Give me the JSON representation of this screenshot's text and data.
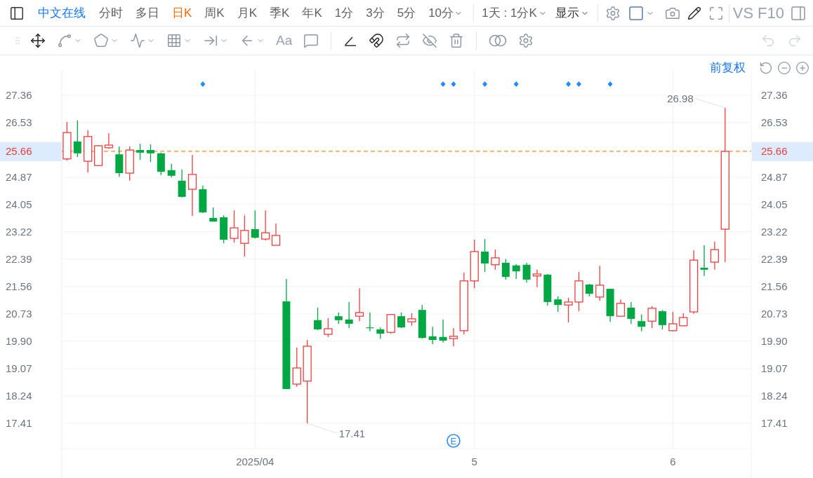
{
  "toolbar": {
    "stock_name": "中文在线",
    "periods": [
      {
        "label": "分时",
        "selected": false,
        "dropdown": false
      },
      {
        "label": "多日",
        "selected": false,
        "dropdown": false
      },
      {
        "label": "日K",
        "selected": true,
        "dropdown": false
      },
      {
        "label": "周K",
        "selected": false,
        "dropdown": false
      },
      {
        "label": "月K",
        "selected": false,
        "dropdown": false
      },
      {
        "label": "季K",
        "selected": false,
        "dropdown": false
      },
      {
        "label": "年K",
        "selected": false,
        "dropdown": false
      },
      {
        "label": "1分",
        "selected": false,
        "dropdown": false
      },
      {
        "label": "3分",
        "selected": false,
        "dropdown": false
      },
      {
        "label": "5分",
        "selected": false,
        "dropdown": false
      },
      {
        "label": "10分",
        "selected": false,
        "dropdown": true
      }
    ],
    "range": "1天 : 1分K",
    "display": "显示",
    "buttons": [
      "VS",
      "F10"
    ]
  },
  "drawing_tools": {
    "text_tool": "Aa",
    "undo": {
      "disabled": true
    },
    "redo": {
      "disabled": true
    }
  },
  "chart": {
    "adjustment": "前复权",
    "chart_data": {
      "type": "candlestick",
      "grid": true,
      "ylim": [
        16.645,
        28.125
      ],
      "categories": [
        null,
        null,
        null,
        null,
        null,
        null,
        null,
        null,
        null,
        null,
        null,
        null,
        null,
        null,
        null,
        null,
        null,
        null,
        "2025/04",
        null,
        null,
        null,
        null,
        null,
        null,
        null,
        null,
        null,
        null,
        null,
        null,
        null,
        null,
        null,
        null,
        null,
        null,
        null,
        null,
        "5",
        null,
        null,
        null,
        null,
        null,
        null,
        null,
        null,
        null,
        null,
        null,
        null,
        null,
        null,
        null,
        null,
        null,
        null,
        "6",
        null,
        null,
        null,
        null,
        null,
        null,
        null
      ],
      "yticks": [
        {
          "value": 27.36,
          "label": "27.36"
        },
        {
          "value": 26.53,
          "label": "26.53"
        },
        {
          "value": 24.87,
          "label": "24.87"
        },
        {
          "value": 24.05,
          "label": "24.05"
        },
        {
          "value": 23.22,
          "label": "23.22"
        },
        {
          "value": 22.39,
          "label": "22.39"
        },
        {
          "value": 21.56,
          "label": "21.56"
        },
        {
          "value": 20.73,
          "label": "20.73"
        },
        {
          "value": 19.9,
          "label": "19.90"
        },
        {
          "value": 19.07,
          "label": "19.07"
        },
        {
          "value": 18.24,
          "label": "18.24"
        },
        {
          "value": 17.41,
          "label": "17.41"
        }
      ],
      "ohlc": [
        [
          25.43,
          26.55,
          25.38,
          26.23
        ],
        [
          25.96,
          26.6,
          25.49,
          25.6
        ],
        [
          25.36,
          26.3,
          25.02,
          26.11
        ],
        [
          25.23,
          25.85,
          25.21,
          25.83
        ],
        [
          25.77,
          26.21,
          25.74,
          25.85
        ],
        [
          25.57,
          25.81,
          24.89,
          25.0
        ],
        [
          25.0,
          25.81,
          24.77,
          25.7
        ],
        [
          25.7,
          25.89,
          25.4,
          25.62
        ],
        [
          25.7,
          25.87,
          25.34,
          25.6
        ],
        [
          25.6,
          25.62,
          24.94,
          25.04
        ],
        [
          25.09,
          25.28,
          24.87,
          24.92
        ],
        [
          24.77,
          25.11,
          24.26,
          24.28
        ],
        [
          24.51,
          25.55,
          23.7,
          24.96
        ],
        [
          24.51,
          24.62,
          23.79,
          23.81
        ],
        [
          23.64,
          23.96,
          23.52,
          23.53
        ],
        [
          23.66,
          23.72,
          22.87,
          22.98
        ],
        [
          23.02,
          23.87,
          22.89,
          23.34
        ],
        [
          22.87,
          23.72,
          22.47,
          23.26
        ],
        [
          23.3,
          23.87,
          23.02,
          23.04
        ],
        [
          23.0,
          23.87,
          22.96,
          23.19
        ],
        [
          22.81,
          23.47,
          22.81,
          23.11
        ],
        [
          21.11,
          21.79,
          18.45,
          18.45
        ],
        [
          18.6,
          19.71,
          18.52,
          19.09
        ],
        [
          18.69,
          19.94,
          17.41,
          19.75
        ],
        [
          20.54,
          20.92,
          20.24,
          20.26
        ],
        [
          20.11,
          20.6,
          20.03,
          20.28
        ],
        [
          20.66,
          20.77,
          20.43,
          20.54
        ],
        [
          20.56,
          21.09,
          20.3,
          20.43
        ],
        [
          20.66,
          21.51,
          20.51,
          20.77
        ],
        [
          20.32,
          20.77,
          20.2,
          20.3
        ],
        [
          20.26,
          20.32,
          19.98,
          20.13
        ],
        [
          20.17,
          20.72,
          20.13,
          20.71
        ],
        [
          20.66,
          20.77,
          20.3,
          20.32
        ],
        [
          20.49,
          20.75,
          20.37,
          20.58
        ],
        [
          20.85,
          21.0,
          19.98,
          20.0
        ],
        [
          20.05,
          20.34,
          19.81,
          19.94
        ],
        [
          20.03,
          20.56,
          19.86,
          19.92
        ],
        [
          19.98,
          20.3,
          19.75,
          20.05
        ],
        [
          20.22,
          21.98,
          20.11,
          21.73
        ],
        [
          21.73,
          22.98,
          21.51,
          22.62
        ],
        [
          22.62,
          23.0,
          22.0,
          22.26
        ],
        [
          22.22,
          22.68,
          22.07,
          22.43
        ],
        [
          22.28,
          22.39,
          21.77,
          21.85
        ],
        [
          22.2,
          22.24,
          21.79,
          22.02
        ],
        [
          22.22,
          22.28,
          21.68,
          21.77
        ],
        [
          21.88,
          22.07,
          21.54,
          21.94
        ],
        [
          21.92,
          21.94,
          20.98,
          21.09
        ],
        [
          21.17,
          21.26,
          20.79,
          21.0
        ],
        [
          21.0,
          21.22,
          20.47,
          21.09
        ],
        [
          21.09,
          22.0,
          20.81,
          21.73
        ],
        [
          21.62,
          21.64,
          21.26,
          21.34
        ],
        [
          21.24,
          22.19,
          21.13,
          21.6
        ],
        [
          21.49,
          21.5,
          20.49,
          20.66
        ],
        [
          20.66,
          21.17,
          20.64,
          21.05
        ],
        [
          20.92,
          21.09,
          20.43,
          20.58
        ],
        [
          20.51,
          20.71,
          20.2,
          20.34
        ],
        [
          20.51,
          20.96,
          20.3,
          20.9
        ],
        [
          20.81,
          20.85,
          20.26,
          20.39
        ],
        [
          20.22,
          20.79,
          20.2,
          20.43
        ],
        [
          20.37,
          20.75,
          20.36,
          20.62
        ],
        [
          20.79,
          22.66,
          20.73,
          22.36
        ],
        [
          22.13,
          22.81,
          21.88,
          22.07
        ],
        [
          22.3,
          22.92,
          22.07,
          22.68
        ],
        [
          23.3,
          26.98,
          22.3,
          25.66
        ],
        null,
        null
      ],
      "ref_lines": [
        {
          "axis": "y",
          "value": 25.66,
          "label": "25.66"
        }
      ],
      "annotations": [
        "26.98",
        "17.41"
      ]
    },
    "diamond_marks": [
      false,
      false,
      false,
      false,
      false,
      false,
      false,
      false,
      false,
      false,
      false,
      false,
      false,
      true,
      false,
      false,
      false,
      false,
      false,
      false,
      false,
      false,
      false,
      false,
      false,
      false,
      false,
      false,
      false,
      false,
      false,
      false,
      false,
      false,
      false,
      false,
      true,
      true,
      false,
      false,
      true,
      false,
      false,
      true,
      false,
      false,
      false,
      false,
      true,
      true,
      false,
      false,
      true,
      false,
      false,
      false,
      false,
      false,
      false,
      false,
      false,
      false,
      false,
      false
    ],
    "event_badge": {
      "text": "E",
      "marks": [
        false,
        false,
        false,
        false,
        false,
        false,
        false,
        false,
        false,
        false,
        false,
        false,
        false,
        false,
        false,
        false,
        false,
        false,
        false,
        false,
        false,
        false,
        false,
        false,
        false,
        false,
        false,
        false,
        false,
        false,
        false,
        false,
        false,
        false,
        false,
        false,
        false,
        true,
        false,
        false,
        false,
        false,
        false,
        false,
        false,
        false,
        false,
        false,
        false,
        false,
        false,
        false,
        false,
        false,
        false,
        false,
        false,
        false,
        false,
        false,
        false,
        false,
        false,
        false
      ]
    }
  }
}
